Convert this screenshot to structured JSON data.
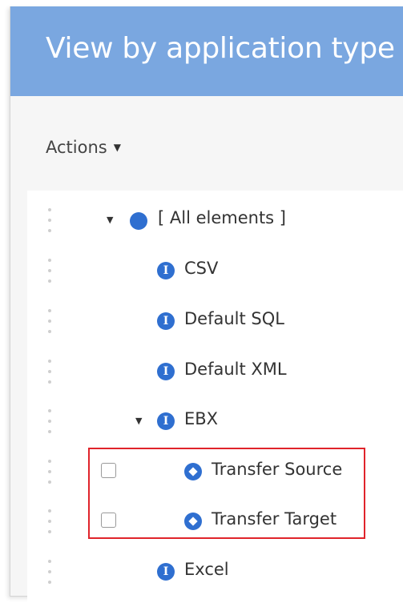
{
  "header": {
    "title": "View by application type"
  },
  "toolbar": {
    "actions_label": "Actions"
  },
  "tree": {
    "rows": [
      {
        "label": "[ All elements ]"
      },
      {
        "label": "CSV"
      },
      {
        "label": "Default SQL"
      },
      {
        "label": "Default XML"
      },
      {
        "label": "EBX"
      },
      {
        "label": "Transfer Source"
      },
      {
        "label": "Transfer Target"
      },
      {
        "label": "Excel"
      }
    ]
  },
  "colors": {
    "header_bg": "#7aa7e0",
    "icon_blue": "#2f6fd0",
    "highlight_border": "#e0242b"
  }
}
